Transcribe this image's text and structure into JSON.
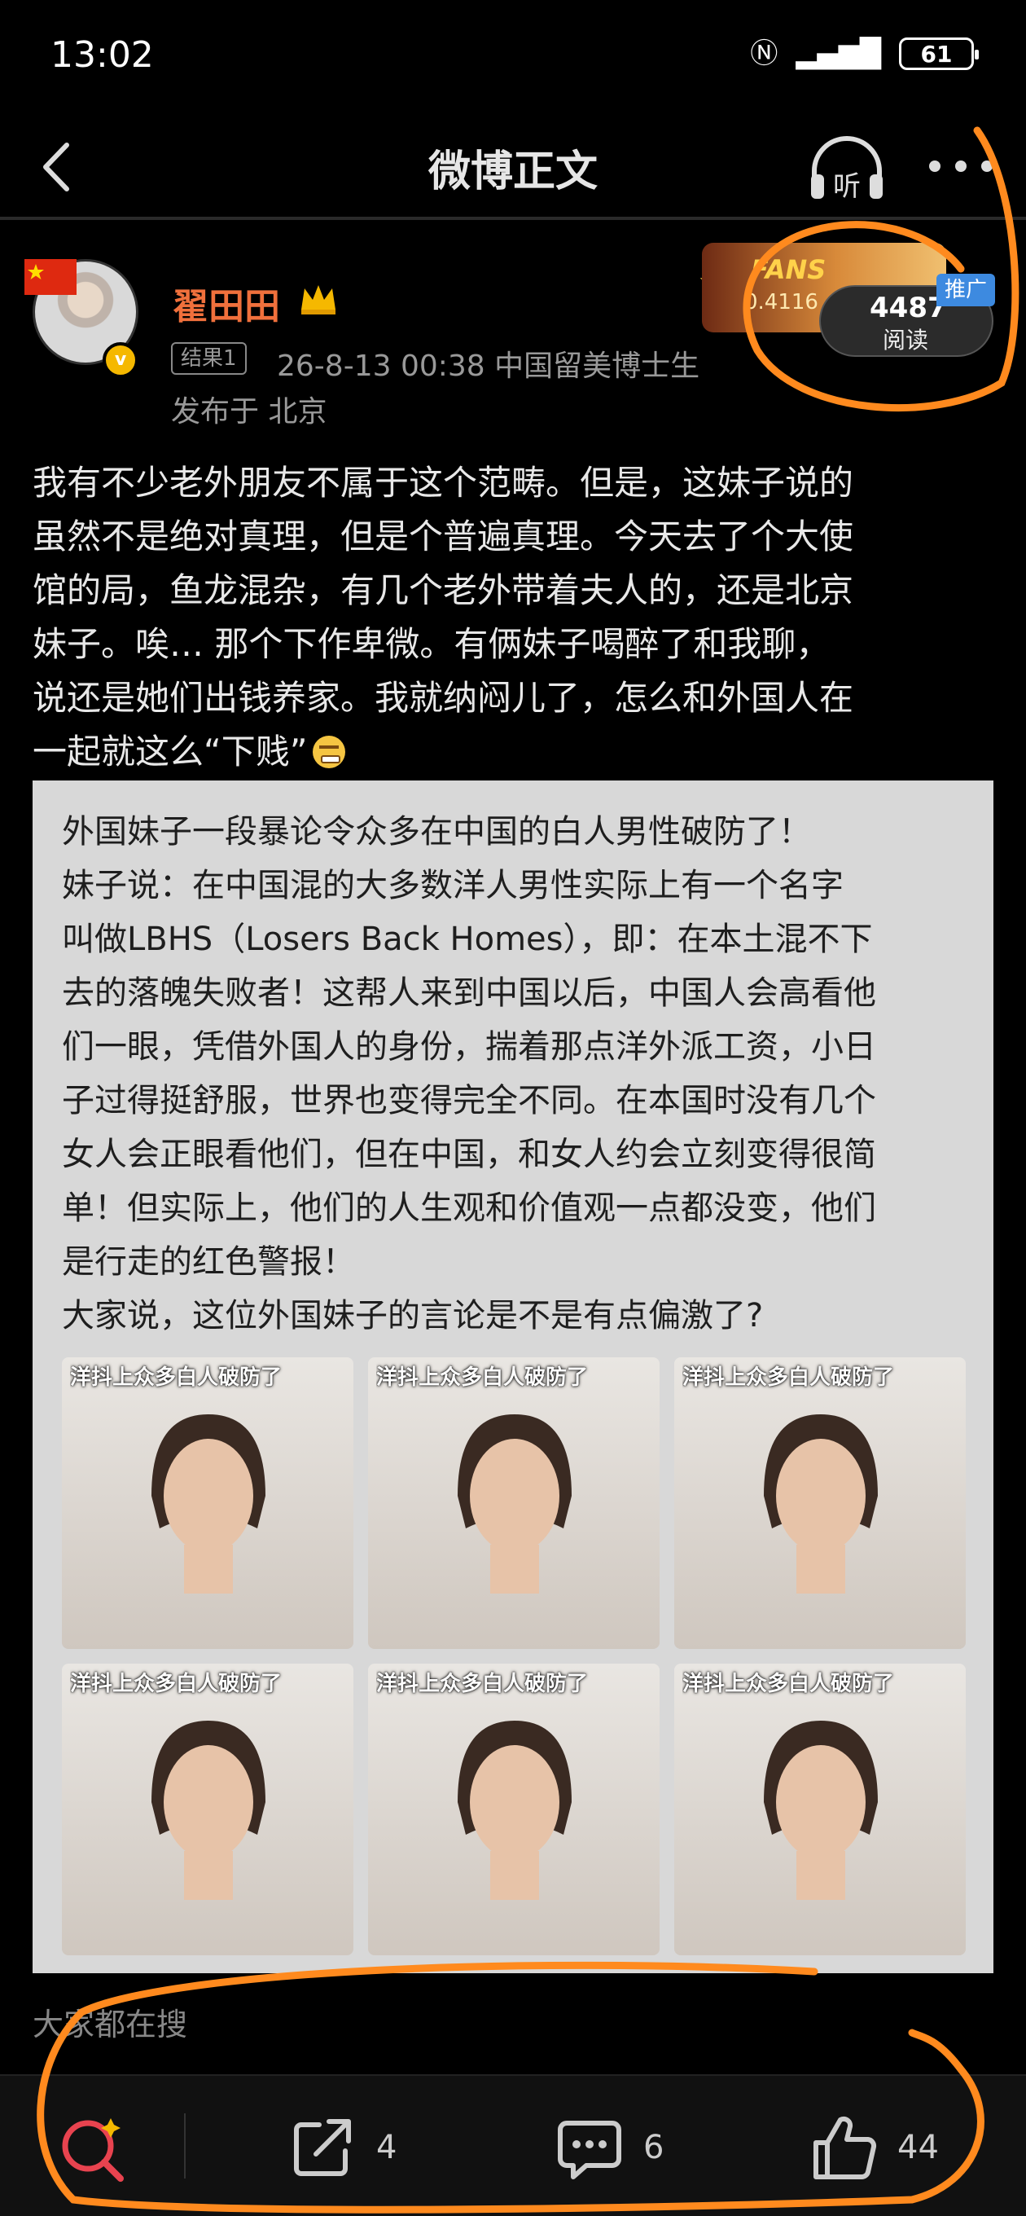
{
  "status_bar": {
    "time": "13:02",
    "battery": "61"
  },
  "nav": {
    "title": "微博正文",
    "listen_label": "听"
  },
  "post": {
    "author": "翟田田",
    "rank_badge": "结果1",
    "meta": "26-8-13 00:38  中国留美博士生",
    "location": "发布于 北京",
    "fans_badge": {
      "label": "FANS",
      "number": "0.4116"
    },
    "reads": {
      "count": "4487",
      "label": "阅读"
    },
    "promo_tag": "推广",
    "text": "我有不少老外朋友不属于这个范畴。但是，这妹子说的\n虽然不是绝对真理，但是个普遍真理。今天去了个大使\n馆的局，鱼龙混杂，有几个老外带着夫人的，还是北京\n妹子。唉… 那个下作卑微。有俩妹子喝醉了和我聊，\n说还是她们出钱养家。我就纳闷儿了，怎么和外国人在\n一起就这么“下贱”",
    "image": {
      "text": "外国妹子一段暴论令众多在中国的白人男性破防了！\n妹子说：在中国混的大多数洋人男性实际上有一个名字\n叫做LBHS（Losers Back Homes），即：在本土混不下\n去的落魄失败者！这帮人来到中国以后，中国人会高看他\n们一眼，凭借外国人的身份，揣着那点洋外派工资，小日\n子过得挺舒服，世界也变得完全不同。在本国时没有几个\n女人会正眼看他们，但在中国，和女人约会立刻变得很简\n单！但实际上，他们的人生观和价值观一点都没变，他们\n是行走的红色警报！\n大家说，这位外国妹子的言论是不是有点偏激了?",
      "thumbnails": [
        {
          "caption": "洋抖上众多白人破防了"
        },
        {
          "caption": "洋抖上众多白人破防了"
        },
        {
          "caption": "洋抖上众多白人破防了"
        },
        {
          "caption": "洋抖上众多白人破防了"
        },
        {
          "caption": "洋抖上众多白人破防了"
        },
        {
          "caption": "洋抖上众多白人破防了"
        }
      ]
    }
  },
  "trending_label": "大家都在搜",
  "bottom_bar": {
    "repost_count": "4",
    "comment_count": "6",
    "like_count": "44"
  },
  "colors": {
    "author": "#f0703c",
    "annotation": "#ff8a1e",
    "promo": "#3d8ae0"
  },
  "icons": [
    "back-icon",
    "headphones-icon",
    "more-icon",
    "crown-icon",
    "verified-icon",
    "search-icon",
    "repost-icon",
    "comment-icon",
    "like-icon"
  ]
}
